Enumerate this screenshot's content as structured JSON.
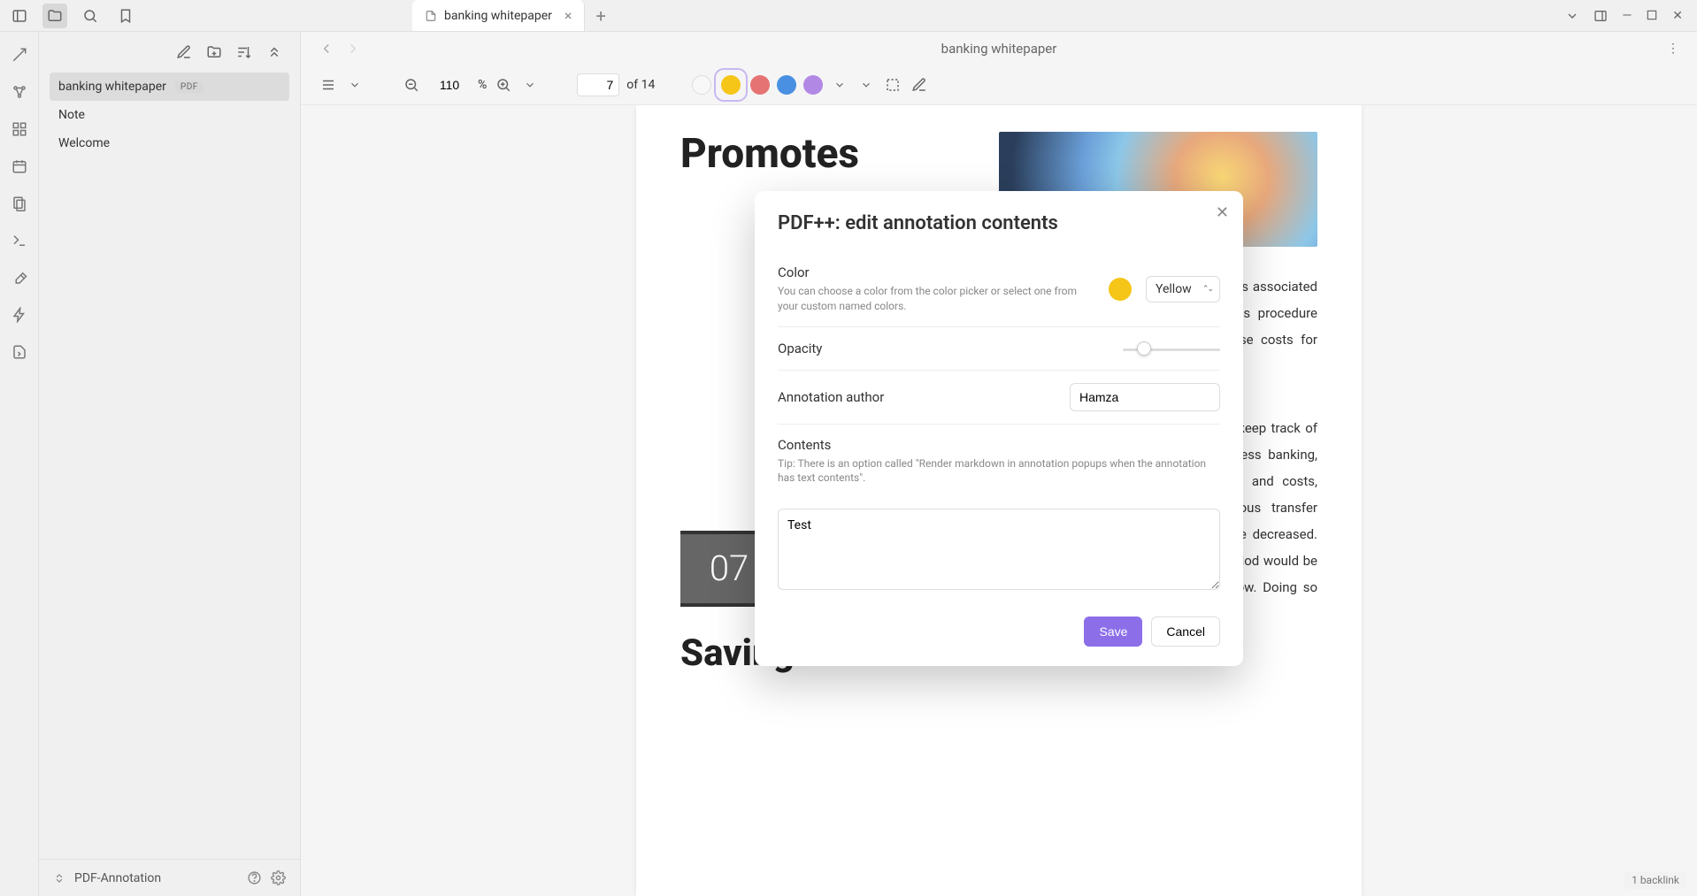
{
  "tab": {
    "title": "banking whitepaper"
  },
  "sidebar": {
    "items": [
      {
        "label": "banking whitepaper",
        "badge": "PDF"
      },
      {
        "label": "Note"
      },
      {
        "label": "Welcome"
      }
    ],
    "footer": "PDF-Annotation"
  },
  "doc": {
    "title": "banking whitepaper",
    "zoom": "110",
    "zoom_pct": "%",
    "page_current": "7",
    "page_of": "of 14",
    "heading1": "Promotes",
    "section_num": "07",
    "heading2": "Saving",
    "para1": "of human mistakes, labor expenses, tures associated with processing docu-d decrease if this procedure were con-electronic one. Reducing these costs for improved service and increased",
    "para2": "ons, people have utilized the passbook keep track of their debts and other . Through paperless banking, transac-tion expenses, printing hassles and costs, physical handling of papers, continuous transfer costs, and redemption fees might all be decreased. As a result, the banks' debit recovery period would be short-ened, and their liquidity would grow. Doing so could"
  },
  "modal": {
    "title": "PDF++: edit annotation contents",
    "color_label": "Color",
    "color_hint": "You can choose a color from the color picker or select one from your custom named colors.",
    "color_value": "Yellow",
    "opacity_label": "Opacity",
    "author_label": "Annotation author",
    "author_value": "Hamza",
    "contents_label": "Contents",
    "contents_hint": "Tip: There is an option called \"Render markdown in annotation popups when the annotation has text contents\".",
    "contents_value": "Test",
    "save": "Save",
    "cancel": "Cancel"
  },
  "footer": {
    "backlink": "1 backlink"
  }
}
